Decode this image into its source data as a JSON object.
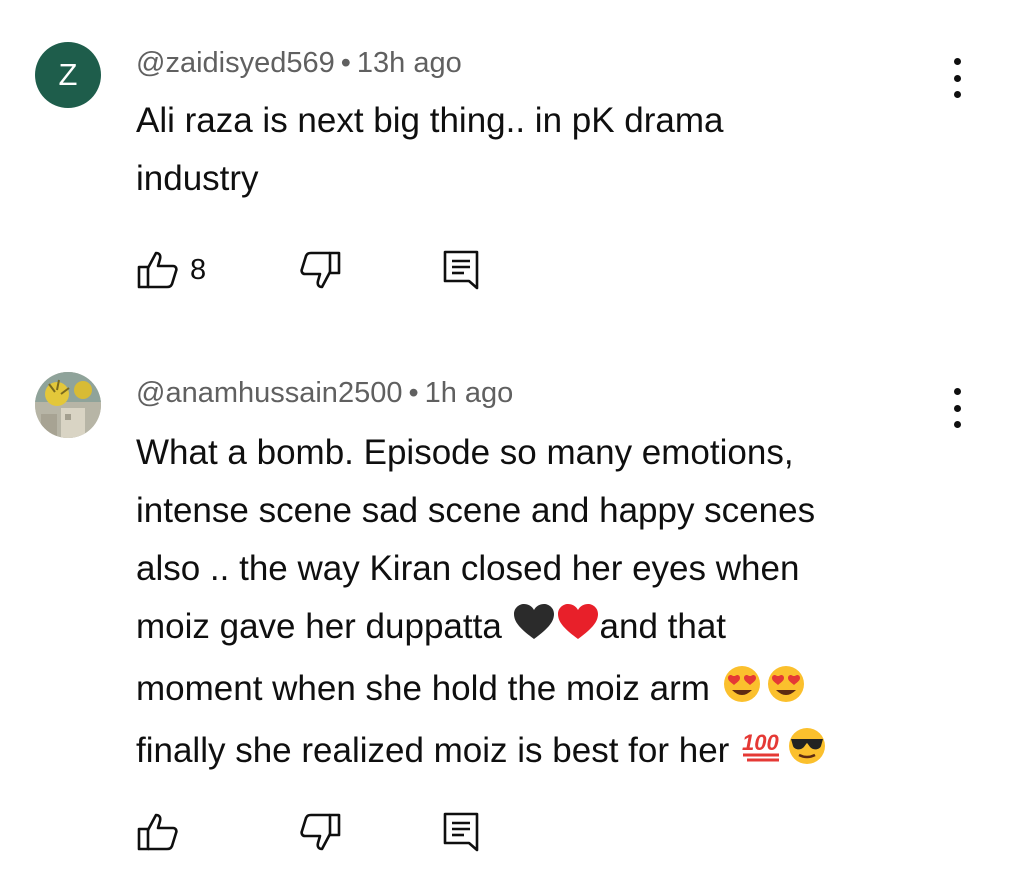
{
  "comments": [
    {
      "avatar_letter": "Z",
      "avatar_color": "#1e5d4b",
      "handle": "@zaidisyed569",
      "separator": "•",
      "time": "13h ago",
      "lines": [
        "Ali raza is next big thing.. in pK drama",
        "industry"
      ],
      "like_count": "8"
    },
    {
      "avatar_letter": "",
      "handle": "@anamhussain2500",
      "separator": "•",
      "time": "1h ago",
      "lines": [
        "What a bomb.  Episode so many emotions,",
        "intense scene sad scene and happy scenes",
        "also .. the way Kiran closed her eyes when",
        "moiz  gave her duppatta ",
        "and  that",
        "moment when  she hold the moiz arm ",
        "finally she realized moiz is best for her "
      ],
      "emojis": [
        "black-heart",
        "red-heart",
        "heart-eyes",
        "heart-eyes",
        "hundred-points",
        "sunglasses-face"
      ],
      "like_count": ""
    }
  ],
  "icons": [
    "thumbs-up-icon",
    "thumbs-down-icon",
    "reply-icon",
    "more-options-icon"
  ]
}
